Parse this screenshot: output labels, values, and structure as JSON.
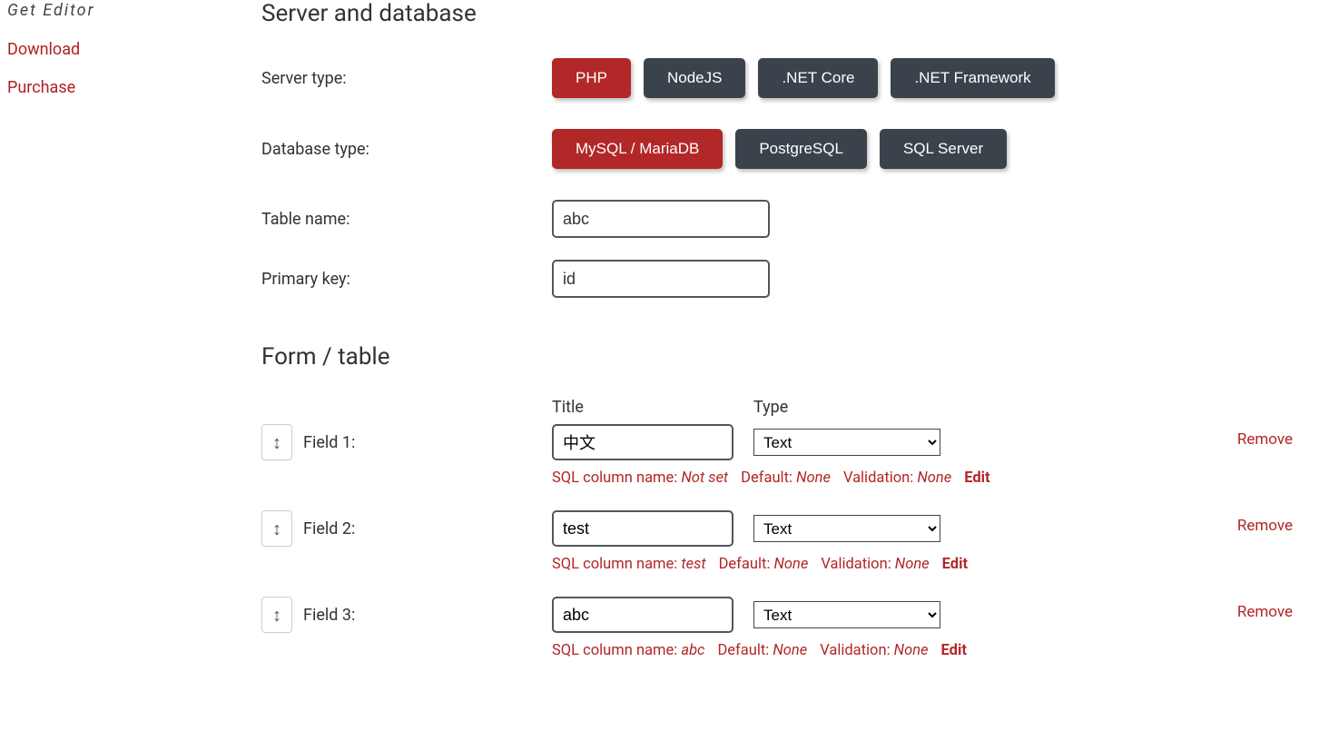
{
  "sidebar": {
    "get_editor": "Get Editor",
    "download": "Download",
    "purchase": "Purchase"
  },
  "sections": {
    "server_db_heading": "Server and database",
    "form_table_heading": "Form / table"
  },
  "labels": {
    "server_type": "Server type:",
    "database_type": "Database type:",
    "table_name": "Table name:",
    "primary_key": "Primary key:",
    "title_header": "Title",
    "type_header": "Type",
    "sql_column_prefix": "SQL column name:",
    "default_prefix": "Default:",
    "validation_prefix": "Validation:",
    "edit": "Edit",
    "remove": "Remove"
  },
  "server_types": {
    "php": "PHP",
    "nodejs": "NodeJS",
    "net_core": ".NET Core",
    "net_framework": ".NET Framework",
    "selected": "php"
  },
  "database_types": {
    "mysql": "MySQL / MariaDB",
    "postgres": "PostgreSQL",
    "sqlserver": "SQL Server",
    "selected": "mysql"
  },
  "inputs": {
    "table_name": "abc",
    "primary_key": "id"
  },
  "type_options": {
    "text": "Text"
  },
  "fields": [
    {
      "label": "Field 1:",
      "title": "中文",
      "type": "Text",
      "sql_column": "Not set",
      "default": "None",
      "validation": "None"
    },
    {
      "label": "Field 2:",
      "title": "test",
      "type": "Text",
      "sql_column": "test",
      "default": "None",
      "validation": "None"
    },
    {
      "label": "Field 3:",
      "title": "abc",
      "type": "Text",
      "sql_column": "abc",
      "default": "None",
      "validation": "None"
    }
  ]
}
